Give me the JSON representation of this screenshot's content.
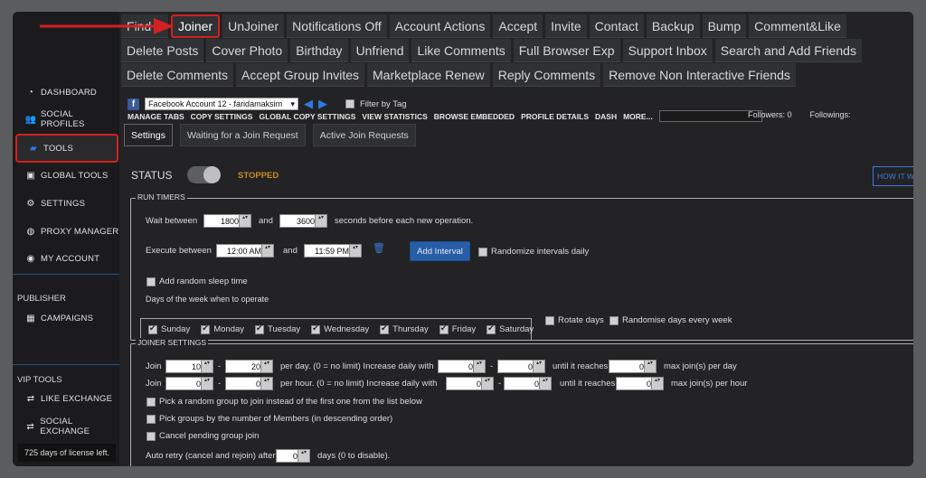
{
  "sidebar": {
    "items": [
      {
        "label": "DASHBOARD",
        "icon": "dashboard-icon"
      },
      {
        "label": "SOCIAL PROFILES",
        "icon": "users-icon"
      },
      {
        "label": "TOOLS",
        "icon": "briefcase-icon"
      },
      {
        "label": "GLOBAL TOOLS",
        "icon": "toolbox-icon"
      },
      {
        "label": "SETTINGS",
        "icon": "gear-icon"
      },
      {
        "label": "PROXY MANAGER",
        "icon": "globe-icon"
      },
      {
        "label": "MY ACCOUNT",
        "icon": "user-circle-icon"
      }
    ],
    "publisher_heading": "PUBLISHER",
    "campaigns": "CAMPAIGNS",
    "vip_heading": "VIP TOOLS",
    "like_exchange": "LIKE EXCHANGE",
    "social_exchange": "SOCIAL EXCHANGE",
    "license": "725 days of license left."
  },
  "tabs": {
    "row1": [
      "Find",
      "Joiner",
      "UnJoiner",
      "Notifications Off",
      "Account Actions",
      "Accept",
      "Invite",
      "Contact",
      "Backup",
      "Bump",
      "Comment&Like"
    ],
    "row2": [
      "Delete Posts",
      "Cover Photo",
      "Birthday",
      "Unfriend",
      "Like Comments",
      "Full Browser Exp",
      "Support Inbox",
      "Search and Add Friends"
    ],
    "row3": [
      "Delete Comments",
      "Accept Group Invites",
      "Marketplace Renew",
      "Reply Comments",
      "Remove Non Interactive Friends"
    ],
    "active": "Joiner"
  },
  "account": {
    "selected": "Facebook Account 12 - faridamaksim",
    "filter_label": "Filter by Tag"
  },
  "menu": [
    "MANAGE TABS",
    "COPY SETTINGS",
    "GLOBAL COPY SETTINGS",
    "VIEW STATISTICS",
    "BROWSE EMBEDDED",
    "PROFILE DETAILS",
    "DASH",
    "MORE..."
  ],
  "stats": {
    "followers": "Followers: 0",
    "followings": "Followings:"
  },
  "subtabs": [
    "Settings",
    "Waiting for a Join Request",
    "Active Join Requests"
  ],
  "status": {
    "label": "STATUS",
    "value": "STOPPED",
    "how_it_works": "HOW IT WORKS"
  },
  "run_timers": {
    "legend": "RUN TIMERS",
    "wait_between": "Wait between",
    "wait_min": "1800",
    "and": "and",
    "wait_max": "3600",
    "seconds_text": "seconds before each new operation.",
    "execute_between": "Execute between",
    "exec_start": "12:00 AM",
    "exec_end": "11:59 PM",
    "add_interval": "Add Interval",
    "randomize_intervals": "Randomize intervals daily",
    "add_random_sleep": "Add random sleep time",
    "days_label": "Days of the week when to operate",
    "days": [
      "Sunday",
      "Monday",
      "Tuesday",
      "Wednesday",
      "Thursday",
      "Friday",
      "Saturday"
    ],
    "rotate_days": "Rotate days",
    "randomise_days": "Randomise days every week"
  },
  "joiner_settings": {
    "legend": "JOINER SETTINGS",
    "join": "Join",
    "day_min": "10",
    "day_max": "20",
    "per_day_text": "per day. (0 = no limit)  Increase daily with",
    "inc_day_min": "0",
    "inc_day_max": "0",
    "until_reaches": "until it reaches",
    "max_day": "0",
    "max_day_text": "max join(s) per day",
    "hour_min": "0",
    "hour_max": "0",
    "per_hour_text": "per hour. (0 = no limit)  Increase daily with",
    "inc_hour_min": "0",
    "inc_hour_max": "0",
    "max_hour": "0",
    "max_hour_text": "max join(s) per hour",
    "dash": "-",
    "random_group": "Pick a random group to join instead of the first one from the list below",
    "by_members": "Pick groups by the number of Members (in descending order)",
    "cancel_pending": "Cancel pending group join",
    "auto_retry": "Auto retry (cancel and rejoin) after",
    "auto_retry_val": "0",
    "auto_retry_suffix": "days (0 to disable)."
  },
  "colors": {
    "highlight": "#d42020",
    "accent": "#3a7bd5",
    "stopped": "#c88a20"
  }
}
